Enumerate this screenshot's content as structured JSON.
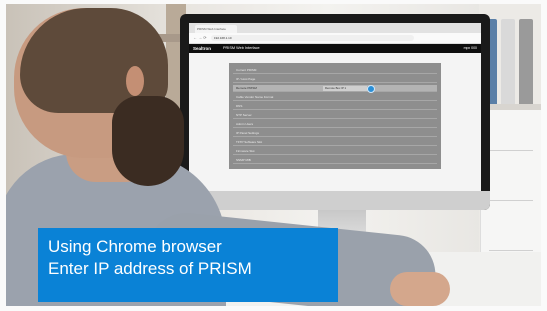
{
  "caption": {
    "line1": "Using Chrome browser",
    "line2": "Enter IP address of PRISM"
  },
  "browser": {
    "tab_title": "PRISM Web Interface",
    "url": "192.168.1.10"
  },
  "app": {
    "logo": "Sealtron",
    "title": "PRISM Web Interface",
    "right_label": "mpx 000"
  },
  "panel_rows": [
    {
      "label": "Current PRISM"
    },
    {
      "label": "IP / Host Page"
    },
    {
      "label": "Remote PRISM",
      "selected": true,
      "value": "Remote Box IP 1"
    },
    {
      "label": "Cable Vendor Name Format"
    },
    {
      "label": "DNS"
    },
    {
      "label": "NTP Server"
    },
    {
      "label": "Admin Users"
    },
    {
      "label": "IP Panel Settings"
    },
    {
      "label": "TFTP Software Slot"
    },
    {
      "label": "Firmware Slot"
    },
    {
      "label": "SNMP MIB"
    }
  ],
  "colors": {
    "caption_bg": "#0a82d6",
    "app_bar": "#0e0e0e",
    "panel": "#8e8e8e"
  }
}
